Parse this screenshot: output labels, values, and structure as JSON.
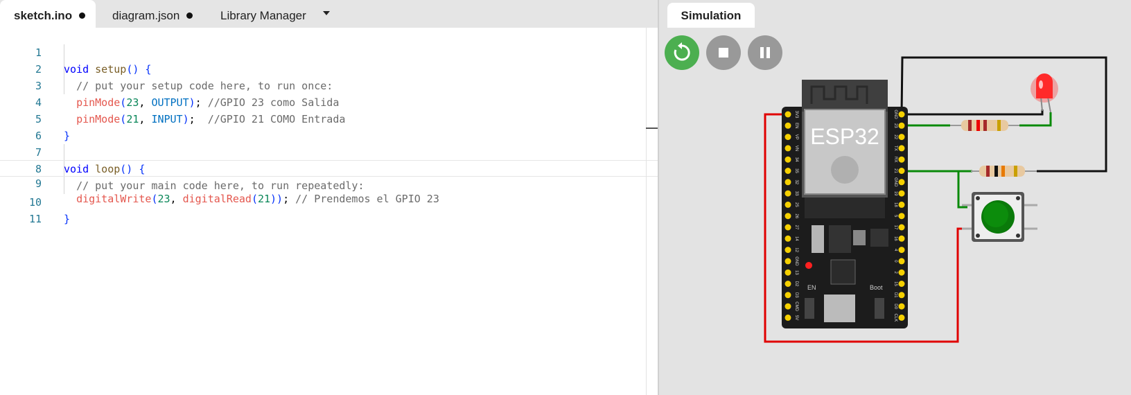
{
  "tabs": [
    {
      "label": "sketch.ino",
      "modified": true,
      "active": true
    },
    {
      "label": "diagram.json",
      "modified": true,
      "active": false
    },
    {
      "label": "Library Manager",
      "modified": false,
      "active": false
    }
  ],
  "code": {
    "line_numbers": [
      "1",
      "2",
      "3",
      "4",
      "5",
      "6",
      "7",
      "8",
      "9",
      "10",
      "11"
    ],
    "current_line": 9
  },
  "simulation": {
    "tab_label": "Simulation",
    "controls": [
      "restart-icon",
      "stop-icon",
      "pause-icon"
    ],
    "board": {
      "name": "ESP32",
      "en_label": "EN",
      "boot_label": "Boot",
      "left_pins": [
        "3V3",
        "EN",
        "VP",
        "VN",
        "34",
        "35",
        "32",
        "33",
        "25",
        "26",
        "27",
        "14",
        "12",
        "GND",
        "13",
        "D2",
        "D3",
        "CMD",
        "5V"
      ],
      "right_pins": [
        "GND",
        "23",
        "22",
        "TX",
        "RX",
        "21",
        "GND",
        "19",
        "18",
        "5",
        "17",
        "16",
        "4",
        "0",
        "2",
        "15",
        "D1",
        "D0",
        "CLK"
      ]
    },
    "colors": {
      "wire_red": "#e00000",
      "wire_green": "#0a8a0a",
      "wire_black": "#111111",
      "button": "#0a7a0a",
      "led": "#ff2a2a",
      "restart": "#4caf50"
    }
  }
}
